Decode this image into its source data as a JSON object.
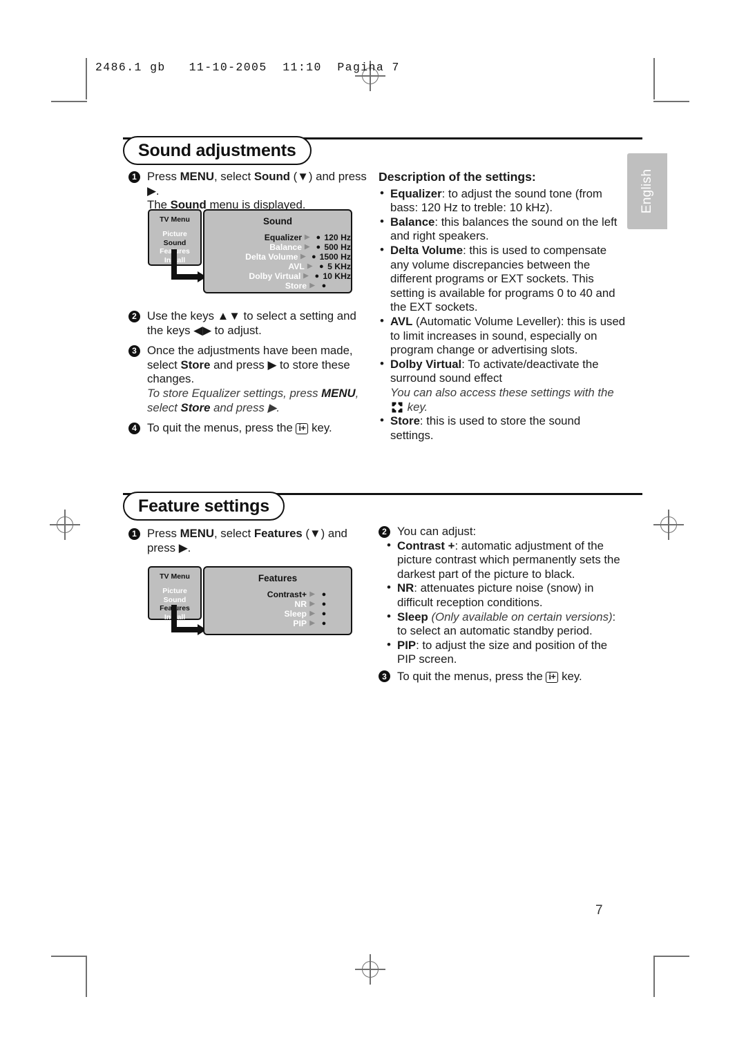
{
  "printer_slug": "2486.1 gb   11-10-2005  11:10  Pagina 7",
  "language_tab": {
    "label": "English"
  },
  "page_number": "7",
  "colors": {
    "menu_grey": "#bfbfbf",
    "ink": "#111111",
    "menu_label_inactive": "#ffffff"
  },
  "sections": [
    {
      "title": "Sound adjustments",
      "left_column": {
        "steps": [
          {
            "number": "1",
            "parts": [
              {
                "t": "Press ",
                "s": "n"
              },
              {
                "t": "MENU",
                "s": "b"
              },
              {
                "t": ", select ",
                "s": "n"
              },
              {
                "t": "Sound",
                "s": "b"
              },
              {
                "t": " (▼) and press ▶.",
                "s": "n"
              },
              {
                "t": "The ",
                "s": "n"
              },
              {
                "t": "Sound",
                "s": "b"
              },
              {
                "t": " menu is displayed.",
                "s": "n"
              }
            ],
            "text_line1": "Press MENU, select Sound (▼) and press ▶.",
            "text_line2": "The Sound menu is displayed."
          },
          {
            "number": "2",
            "text": "Use the keys ▲▼ to select a setting and the keys ◀▶ to adjust."
          },
          {
            "number": "3",
            "text": "Once the adjustments have been made, select Store and press ▶ to store these changes.",
            "note": "To store Equalizer settings, press MENU, select Store and press ▶."
          },
          {
            "number": "4",
            "text": "To quit the menus, press the i+ key."
          }
        ]
      },
      "tv_menu": {
        "sidebar_title": "TV Menu",
        "sidebar_items": [
          {
            "label": "Picture",
            "selected": false
          },
          {
            "label": "Sound",
            "selected": true
          },
          {
            "label": "Features",
            "selected": false
          },
          {
            "label": "Install",
            "selected": false
          }
        ],
        "panel_title": "Sound",
        "rows": [
          {
            "label": "Equalizer",
            "selected": true,
            "value": "120 Hz"
          },
          {
            "label": "Balance",
            "selected": false,
            "value": "500 Hz"
          },
          {
            "label": "Delta Volume",
            "selected": false,
            "value": "1500 Hz"
          },
          {
            "label": "AVL",
            "selected": false,
            "value": "5 KHz"
          },
          {
            "label": "Dolby Virtual",
            "selected": false,
            "value": "10 KHz"
          },
          {
            "label": "Store",
            "selected": false,
            "value": ""
          }
        ]
      },
      "right_column": {
        "heading": "Description of the settings:",
        "bullets": [
          {
            "term": "Equalizer",
            "sep": ": ",
            "body": "to adjust the sound tone (from bass: 120 Hz to treble: 10 kHz)."
          },
          {
            "term": "Balance",
            "sep": ": ",
            "body": "this balances the sound on the left and right speakers."
          },
          {
            "term": "Delta Volume",
            "sep": ": ",
            "body": "this is used to compensate any volume discrepancies between the different programs or EXT sockets. This setting is available for programs 0 to 40 and the EXT sockets."
          },
          {
            "term": "AVL",
            "sep": " ",
            "body": "(Automatic Volume Leveller): this is used to limit increases in sound, especially on program change or advertising slots."
          },
          {
            "term": "Dolby Virtual",
            "sep": ": ",
            "body": "To activate/deactivate the surround sound effect"
          },
          {
            "term": "Store",
            "sep": ": ",
            "body": "this is used to store the sound settings."
          }
        ],
        "note_before_key": "You can also access these settings with the",
        "note_after_key": "key."
      }
    },
    {
      "title": "Feature settings",
      "left_column": {
        "steps": [
          {
            "number": "1",
            "text": "Press MENU, select Features (▼) and press ▶."
          }
        ]
      },
      "tv_menu": {
        "sidebar_title": "TV Menu",
        "sidebar_items": [
          {
            "label": "Picture",
            "selected": false
          },
          {
            "label": "Sound",
            "selected": false
          },
          {
            "label": "Features",
            "selected": true
          },
          {
            "label": "Install",
            "selected": false
          }
        ],
        "panel_title": "Features",
        "rows": [
          {
            "label": "Contrast+",
            "selected": true,
            "value": ""
          },
          {
            "label": "NR",
            "selected": false,
            "value": ""
          },
          {
            "label": "Sleep",
            "selected": false,
            "value": ""
          },
          {
            "label": "PIP",
            "selected": false,
            "value": ""
          }
        ]
      },
      "right_column": {
        "step2_number": "2",
        "step2_text": "You can adjust:",
        "bullets": [
          {
            "term": "Contrast +",
            "sep": ": ",
            "body": "automatic adjustment of the picture contrast which permanently sets the darkest part of the picture to black."
          },
          {
            "term": "NR",
            "sep": ": ",
            "body": "attenuates picture noise (snow) in difficult reception conditions."
          },
          {
            "term": "Sleep",
            "sep": " ",
            "italic_note": "(Only available on certain versions)",
            "body": ": to select an automatic standby period."
          },
          {
            "term": "PIP",
            "sep": ": ",
            "body": "to adjust the size and position of the PIP screen."
          }
        ],
        "step3_number": "3",
        "step3_text": "To quit the menus, press the i+ key."
      }
    }
  ],
  "glyphs": {
    "info_key": "i+",
    "up_arrow": "▲",
    "down_arrow": "▼",
    "left_arrow": "◀",
    "right_arrow": "▶",
    "bullet": "•"
  }
}
